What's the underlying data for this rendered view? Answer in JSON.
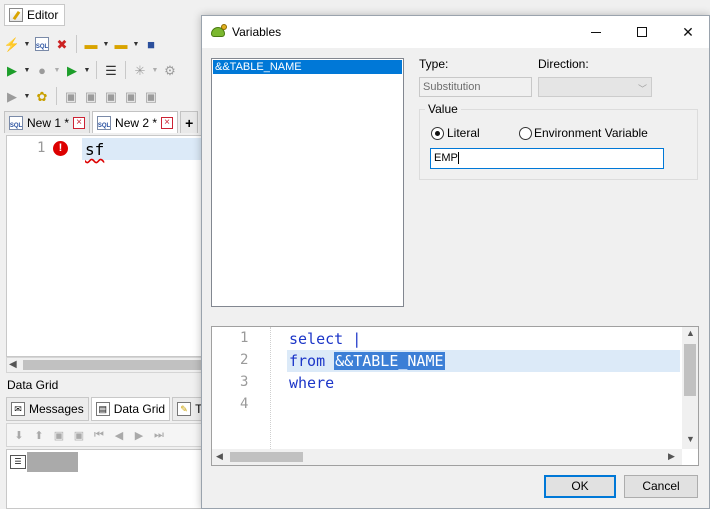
{
  "editor": {
    "tab_label": "Editor",
    "doc_tabs": [
      {
        "label": "New 1 *"
      },
      {
        "label": "New 2 *"
      }
    ],
    "code": {
      "line_number": "1",
      "text": "sf"
    },
    "data_grid_label": "Data Grid",
    "bottom_tabs": [
      {
        "label": "Messages"
      },
      {
        "label": "Data Grid"
      },
      {
        "label": "Tra"
      }
    ]
  },
  "dialog": {
    "title": "Variables",
    "variables": [
      "&&TABLE_NAME"
    ],
    "type_label": "Type:",
    "type_value": "Substitution",
    "direction_label": "Direction:",
    "value_group_label": "Value",
    "radio_literal": "Literal",
    "radio_env": "Environment Variable",
    "value_input": "EMP",
    "sql_lines": [
      {
        "num": "1",
        "text": "select |"
      },
      {
        "num": "2",
        "keyword": "from",
        "variable": "&&TABLE_NAME"
      },
      {
        "num": "3",
        "text": "where"
      },
      {
        "num": "4",
        "text": ""
      }
    ],
    "ok_label": "OK",
    "cancel_label": "Cancel"
  },
  "colors": {
    "selection": "#0078d7",
    "sql_keyword": "#1c36c8",
    "current_line": "#dceaf8",
    "error": "#dd0000"
  }
}
